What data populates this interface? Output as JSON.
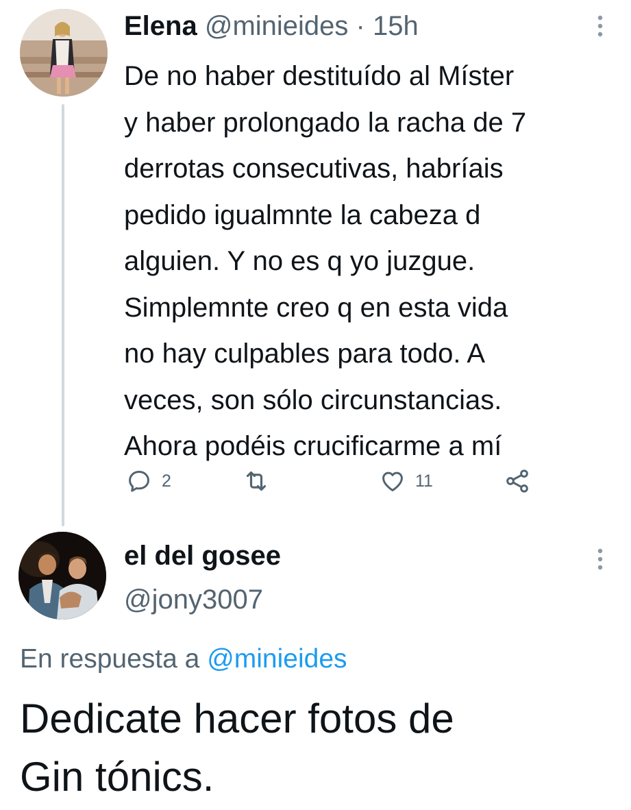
{
  "parent_tweet": {
    "author_name": "Elena",
    "author_handle": "@minieides",
    "separator": "·",
    "time": "15h",
    "avatar_icon": "user-avatar-photo",
    "text_lines": [
      "De no haber destituído al Míster",
      "y haber prolongado la racha de 7",
      "derrotas consecutivas, habríais",
      "pedido igualmnte la cabeza d",
      "alguien. Y no es q yo juzgue.",
      "Simplemnte creo q en esta vida",
      "no hay culpables para todo. A",
      "veces, son sólo circunstancias.",
      "Ahora podéis crucificarme a mí"
    ],
    "actions": {
      "reply_icon": "reply-icon",
      "reply_count": "2",
      "retweet_icon": "retweet-icon",
      "like_icon": "heart-icon",
      "like_count": "11",
      "share_icon": "share-icon"
    }
  },
  "reply_tweet": {
    "author_name": "el del gosee",
    "author_handle": "@jony3007",
    "avatar_icon": "user-avatar-photo",
    "reply_context_prefix": "En respuesta a",
    "reply_context_mention": "@minieides",
    "text_lines": [
      "Dedicate hacer fotos de",
      "Gin tónics."
    ]
  },
  "colors": {
    "text_primary": "#0f1419",
    "text_secondary": "#536471",
    "accent": "#1d9bf0",
    "thread_line": "#cfd9de"
  },
  "more_icon": "more-vertical-icon"
}
